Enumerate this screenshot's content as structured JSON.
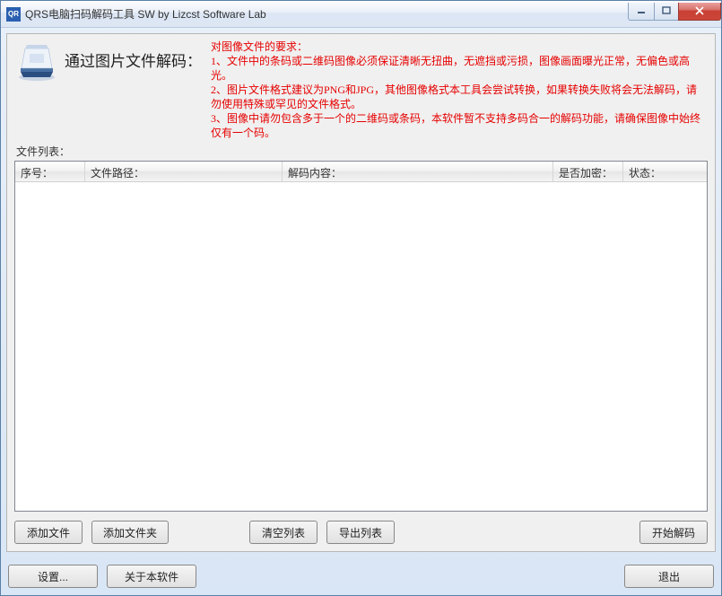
{
  "window": {
    "title": "QRS电脑扫码解码工具 SW  by Lizcst Software Lab"
  },
  "header": {
    "heading": "通过图片文件解码：",
    "requirements": "对图像文件的要求：\n1、文件中的条码或二维码图像必须保证清晰无扭曲，无遮挡或污损，图像画面曝光正常，无偏色或高光。\n2、图片文件格式建议为PNG和JPG，其他图像格式本工具会尝试转换，如果转换失败将会无法解码，请勿使用特殊或罕见的文件格式。\n3、图像中请勿包含多于一个的二维码或条码，本软件暂不支持多码合一的解码功能，请确保图像中始终仅有一个码。"
  },
  "list_label": "文件列表：",
  "columns": {
    "index": "序号：",
    "path": "文件路径：",
    "content": "解码内容：",
    "encrypted": "是否加密：",
    "status": "状态："
  },
  "buttons": {
    "add_file": "添加文件",
    "add_folder": "添加文件夹",
    "clear_list": "清空列表",
    "export_list": "导出列表",
    "start_decode": "开始解码",
    "settings": "设置...",
    "about": "关于本软件",
    "exit": "退出"
  }
}
